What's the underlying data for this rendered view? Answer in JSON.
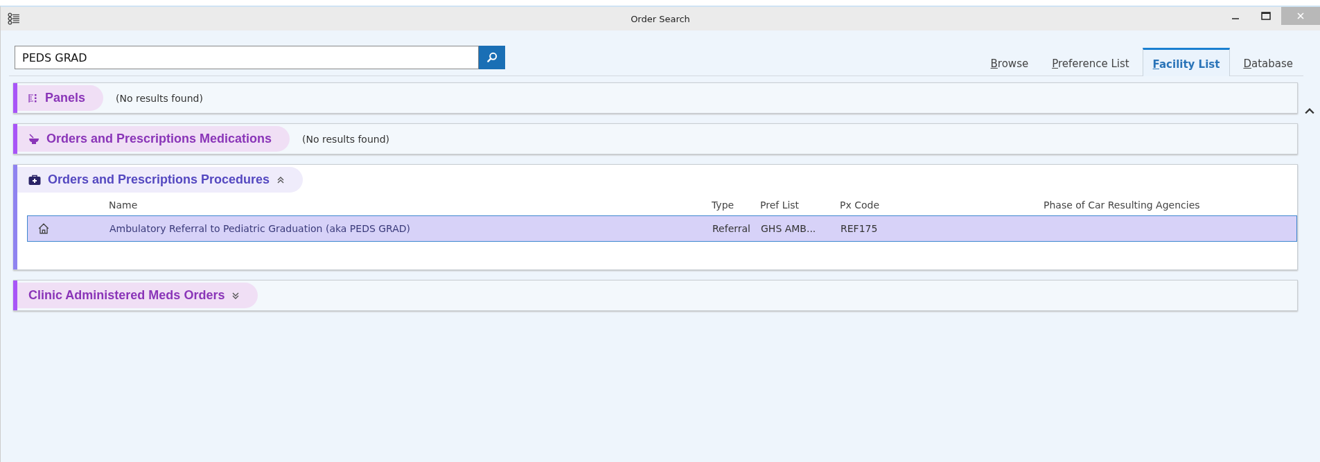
{
  "window": {
    "title": "Order Search"
  },
  "search": {
    "value": "PEDS GRAD"
  },
  "tabs": [
    {
      "label": "Browse",
      "selected": false
    },
    {
      "label": "Preference List",
      "selected": false
    },
    {
      "label": "Facility List",
      "selected": true
    },
    {
      "label": "Database",
      "selected": false
    }
  ],
  "sections": [
    {
      "kind": "panels",
      "title": "Panels",
      "color": "#a855f7",
      "message": "(No results found)"
    },
    {
      "kind": "medication",
      "title": "Orders and Prescriptions Medications",
      "color": "#a855f7",
      "message": "(No results found)"
    },
    {
      "kind": "procedure",
      "title": "Orders and Prescriptions Procedures",
      "color": "#8f83f0",
      "expanded": true,
      "table": {
        "columns": [
          "Name",
          "Type",
          "Pref List",
          "Px Code",
          "Phase of Car Resulting Agencies"
        ],
        "rows": [
          {
            "selected": true,
            "cells": [
              "Ambulatory Referral to Pediatric Graduation (aka PEDS GRAD)",
              "Referral",
              "GHS AMB...",
              "REF175",
              ""
            ]
          }
        ]
      }
    },
    {
      "kind": "plain",
      "title": "Clinic Administered Meds Orders",
      "color": "#a855f7",
      "expanded": false
    }
  ]
}
